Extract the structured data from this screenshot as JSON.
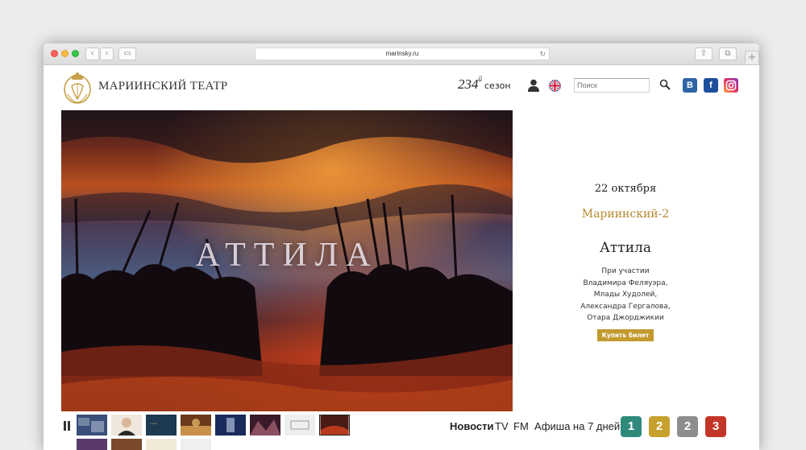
{
  "browser": {
    "url": "marinsky.ru",
    "reload_glyph": "↻",
    "back_glyph": "‹",
    "forward_glyph": "›",
    "sidebar_glyph": "▭",
    "share_glyph": "⇪",
    "tabs_glyph": "⧉",
    "new_tab_glyph": "+"
  },
  "header": {
    "brand": "МАРИИНСКИЙ ТЕАТР",
    "season_number": "234",
    "season_suffix": "й",
    "season_word": "сезон",
    "search_placeholder": "Поиск",
    "social": {
      "vk": "В",
      "fb": "f"
    }
  },
  "hero": {
    "title": "АТТИЛА"
  },
  "event": {
    "date": "22 октября",
    "venue": "Мариинский-2",
    "show": "Аттила",
    "cast": [
      "При участии",
      "Владимира Феляуэра,",
      "Млады Худолей,",
      "Александра Гергалова,",
      "Отара Джорджикии"
    ],
    "buy_label": "Купить билет"
  },
  "bottom_nav": {
    "news": "Новости",
    "tv": "TV",
    "fm": "FM",
    "week": "Афиша на 7 дней",
    "stages": [
      {
        "label": "1",
        "color": "#2f8a7c"
      },
      {
        "label": "2",
        "color": "#c7a12e"
      },
      {
        "label": "2",
        "color": "#8e8e8e"
      },
      {
        "label": "3",
        "color": "#c23527"
      }
    ]
  },
  "colors": {
    "accent_gold": "#b58a2f",
    "button_gold": "#c39a2f"
  }
}
